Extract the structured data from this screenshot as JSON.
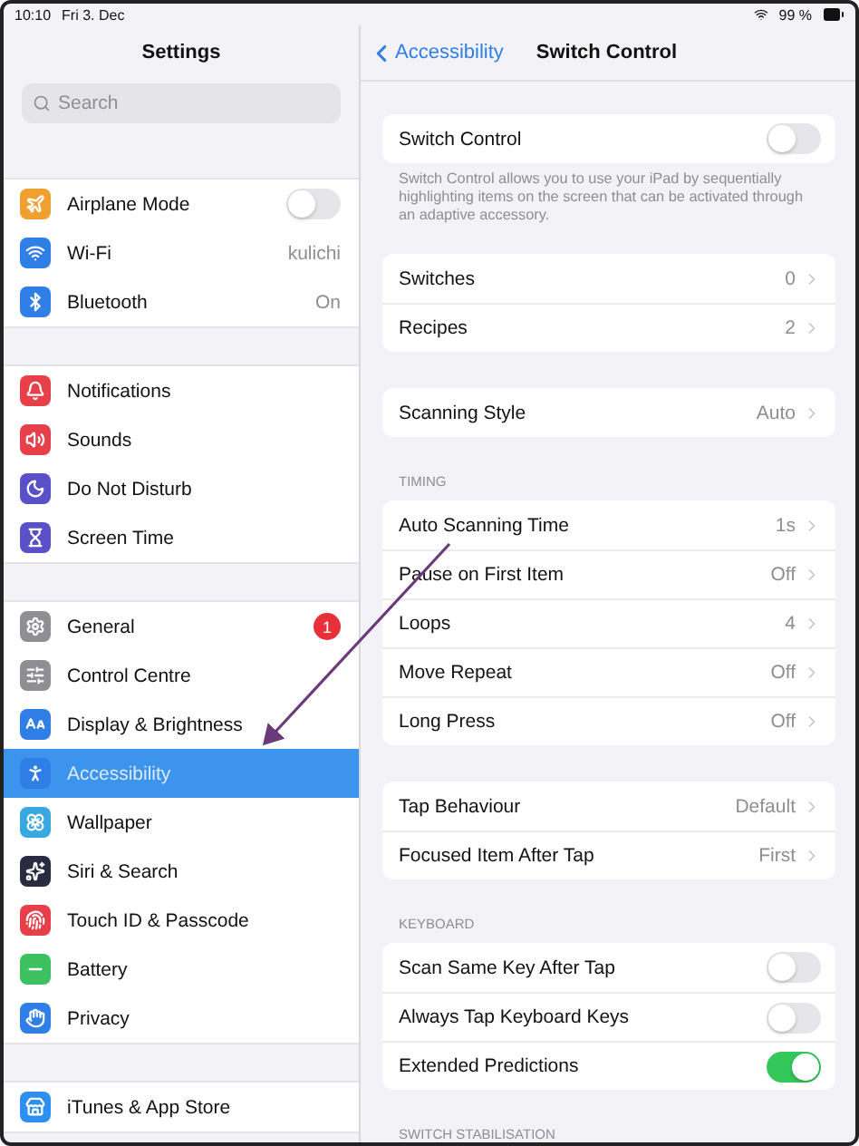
{
  "status_bar": {
    "time": "10:10",
    "date": "Fri 3. Dec",
    "battery": "99 %"
  },
  "sidebar": {
    "title": "Settings",
    "search": {
      "placeholder": "Search"
    },
    "groups": [
      {
        "items": [
          {
            "label": "Airplane Mode",
            "kind": "toggle",
            "on": false,
            "selected": false,
            "color": "#f0a030"
          },
          {
            "label": "Wi-Fi",
            "kind": "value",
            "value": "kulichi",
            "selected": false,
            "color": "#2f7fe6"
          },
          {
            "label": "Bluetooth",
            "kind": "value",
            "value": "On",
            "selected": false,
            "color": "#2f7fe6"
          }
        ]
      },
      {
        "items": [
          {
            "label": "Notifications",
            "kind": "plain",
            "selected": false,
            "color": "#e8404a"
          },
          {
            "label": "Sounds",
            "kind": "plain",
            "selected": false,
            "color": "#e8404a"
          },
          {
            "label": "Do Not Disturb",
            "kind": "plain",
            "selected": false,
            "color": "#5a50c8"
          },
          {
            "label": "Screen Time",
            "kind": "plain",
            "selected": false,
            "color": "#5a50c8"
          }
        ]
      },
      {
        "items": [
          {
            "label": "General",
            "kind": "badge",
            "badge": "1",
            "selected": false,
            "color": "#8e8e93"
          },
          {
            "label": "Control Centre",
            "kind": "plain",
            "selected": false,
            "color": "#8e8e93"
          },
          {
            "label": "Display & Brightness",
            "kind": "plain",
            "selected": false,
            "color": "#2f7fe6"
          },
          {
            "label": "Accessibility",
            "kind": "plain",
            "selected": true,
            "color": "#2f7fe6"
          },
          {
            "label": "Wallpaper",
            "kind": "plain",
            "selected": false,
            "color": "#3aa8e0"
          },
          {
            "label": "Siri & Search",
            "kind": "plain",
            "selected": false,
            "color": "#2a2a40"
          },
          {
            "label": "Touch ID & Passcode",
            "kind": "plain",
            "selected": false,
            "color": "#e8404a"
          },
          {
            "label": "Battery",
            "kind": "plain",
            "selected": false,
            "color": "#3cc060"
          },
          {
            "label": "Privacy",
            "kind": "plain",
            "selected": false,
            "color": "#2f7fe6"
          }
        ]
      },
      {
        "items": [
          {
            "label": "iTunes & App Store",
            "kind": "plain",
            "selected": false,
            "color": "#2f8ff0"
          }
        ]
      }
    ]
  },
  "detail": {
    "back": "Accessibility",
    "title": "Switch Control",
    "sections": [
      {
        "rows": [
          {
            "label": "Switch Control",
            "kind": "toggle",
            "on": false
          }
        ],
        "footer": "Switch Control allows you to use your iPad by sequentially highlighting items on the screen that can be activated through an adaptive accessory."
      },
      {
        "rows": [
          {
            "label": "Switches",
            "kind": "disclosure",
            "value": "0"
          },
          {
            "label": "Recipes",
            "kind": "disclosure",
            "value": "2"
          }
        ]
      },
      {
        "rows": [
          {
            "label": "Scanning Style",
            "kind": "disclosure",
            "value": "Auto"
          }
        ]
      },
      {
        "header": "TIMING",
        "rows": [
          {
            "label": "Auto Scanning Time",
            "kind": "disclosure",
            "value": "1s"
          },
          {
            "label": "Pause on First Item",
            "kind": "disclosure",
            "value": "Off"
          },
          {
            "label": "Loops",
            "kind": "disclosure",
            "value": "4"
          },
          {
            "label": "Move Repeat",
            "kind": "disclosure",
            "value": "Off"
          },
          {
            "label": "Long Press",
            "kind": "disclosure",
            "value": "Off"
          }
        ]
      },
      {
        "rows": [
          {
            "label": "Tap Behaviour",
            "kind": "disclosure",
            "value": "Default"
          },
          {
            "label": "Focused Item After Tap",
            "kind": "disclosure",
            "value": "First"
          }
        ]
      },
      {
        "header": "KEYBOARD",
        "rows": [
          {
            "label": "Scan Same Key After Tap",
            "kind": "toggle",
            "on": false
          },
          {
            "label": "Always Tap Keyboard Keys",
            "kind": "toggle",
            "on": false
          },
          {
            "label": "Extended Predictions",
            "kind": "toggle",
            "on": true
          }
        ]
      },
      {
        "header": "SWITCH STABILISATION"
      }
    ]
  }
}
